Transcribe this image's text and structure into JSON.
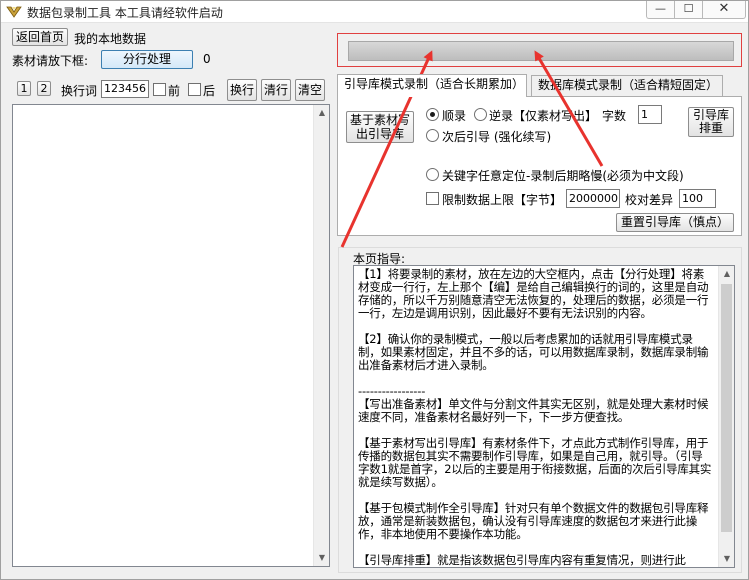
{
  "window": {
    "title": "数据包录制工具  本工具请经软件启动",
    "min_glyph": "—",
    "max_glyph": "☐",
    "close_glyph": "✕"
  },
  "left": {
    "back_button": "返回首页",
    "my_data_label": "我的本地数据",
    "material_label": "素材请放下框:",
    "split_button": "分行处理",
    "count_value": "0",
    "btn_1": "1",
    "btn_2": "2",
    "newline_label": "换行词",
    "newline_value": "123456",
    "front_label": "前",
    "back_label": "后",
    "wrap_button": "换行",
    "clear_line_button": "清行",
    "clear_all_button": "清空"
  },
  "tabs": {
    "tab1": "引导库模式录制（适合长期累加）",
    "tab2": "数据库模式录制（适合精短固定）"
  },
  "panel": {
    "write_guide_button_l1": "基于素材写",
    "write_guide_button_l2": "出引导库",
    "order_label": "顺录",
    "reverse_label": "逆录【仅素材写出】",
    "chars_label": "字数",
    "chars_value": "1",
    "next_guide_label": "次后引导 (强化续写)",
    "sort_button_l1": "引导库",
    "sort_button_l2": "排重",
    "keyword_label": "关键字任意定位-录制后期略慢(必须为中文段)",
    "limit_label": "限制数据上限【字节】",
    "limit_value": "2000000",
    "diff_label": "校对差异",
    "diff_value": "100",
    "reset_button": "重置引导库（慎点）"
  },
  "guide": {
    "title": "本页指导:",
    "paragraphs": [
      "【1】将要录制的素材，放在左边的大空框内，点击【分行处理】将素材变成一行行，左上那个【编】是给自己编辑换行的词的，这里是自动存储的，所以千万别随意清空无法恢复的，处理后的数据，必须是一行一行，左边是调用识别，因此最好不要有无法识别的内容。",
      "【2】确认你的录制模式，一般以后考虑累加的话就用引导库模式录制，如果素材固定，并且不多的话，可以用数据库录制，数据库录制输出准备素材后才进入录制。",
      "-----------------",
      "【写出准备素材】单文件与分割文件其实无区别，就是处理大素材时候速度不同，准备素材名最好列一下，下一步方便查找。",
      "【基于素材写出引导库】有素材条件下，才点此方式制作引导库，用于传播的数据包其实不需要制作引导库，如果是自己用，就引导。（引导字数1就是首字，2以后的主要是用于衔接数据，后面的次后引导库其实就是续写数据）。",
      "【基于包模式制作全引导库】针对只有单个数据文件的数据包引导库释放，通常是新装数据包，确认没有引导库速度的数据包才来进行此操作，非本地使用不要操作本功能。",
      "【引导库排重】就是指该数据包引导库内容有重复情况，则进行此"
    ]
  },
  "colors": {
    "annotation_red": "#e8332e",
    "window_bg": "#f0f0f0"
  }
}
